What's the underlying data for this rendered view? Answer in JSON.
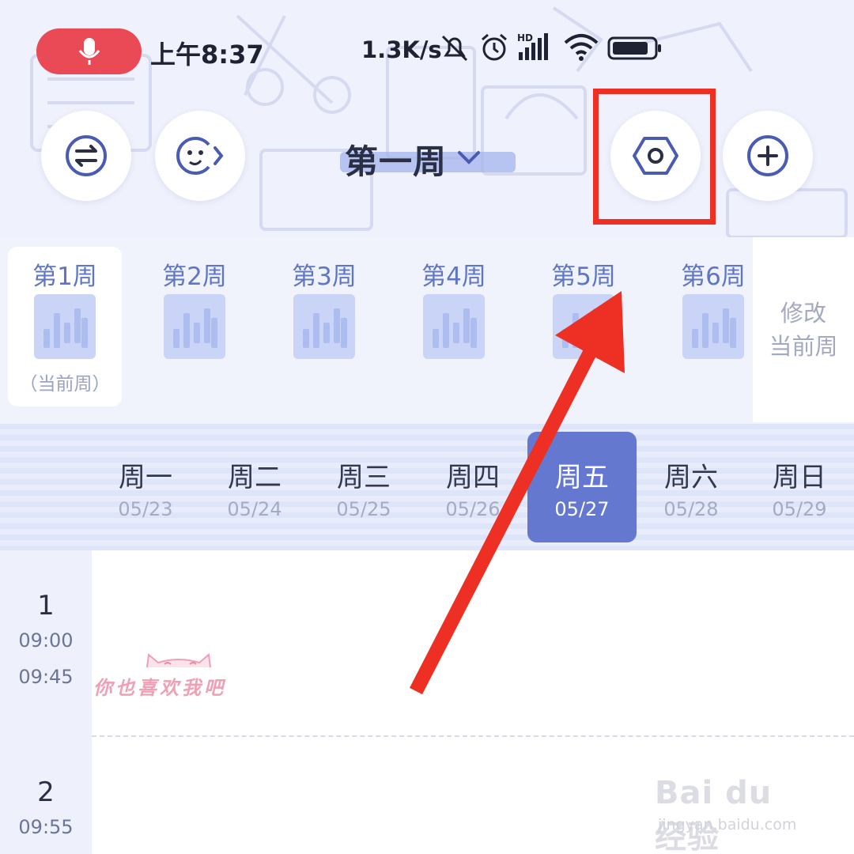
{
  "status_bar": {
    "time": "上午8:37",
    "net_speed": "1.3K/s",
    "icons": [
      "microphone-icon",
      "bell-off-icon",
      "alarm-icon",
      "signal-hd-icon",
      "wifi-icon",
      "battery-icon"
    ],
    "record_color": "#ea4a55"
  },
  "toolbar": {
    "title": "第一周",
    "left_buttons": [
      "swap-icon",
      "face-icon"
    ],
    "right_buttons": [
      "settings-hexagon-icon",
      "add-icon"
    ],
    "highlight_color": "#ee3024"
  },
  "weeks": [
    {
      "label": "第1周",
      "sub": "（当前周）",
      "current": true
    },
    {
      "label": "第2周"
    },
    {
      "label": "第3周"
    },
    {
      "label": "第4周"
    },
    {
      "label": "第5周"
    },
    {
      "label": "第6周"
    }
  ],
  "edit_week": {
    "line1": "修改",
    "line2": "当前周"
  },
  "days": [
    {
      "name": "周一",
      "date": "05/23"
    },
    {
      "name": "周二",
      "date": "05/24"
    },
    {
      "name": "周三",
      "date": "05/25"
    },
    {
      "name": "周四",
      "date": "05/26"
    },
    {
      "name": "周五",
      "date": "05/27",
      "active": true
    },
    {
      "name": "周六",
      "date": "05/28"
    },
    {
      "name": "周日",
      "date": "05/29"
    }
  ],
  "periods": [
    {
      "num": "1",
      "start": "09:00",
      "end": "09:45"
    },
    {
      "num": "2",
      "start": "09:55"
    }
  ],
  "sticker_text": "你也喜欢我吧",
  "watermark": {
    "logo": "Bai du 经验",
    "url": "jingyan.baidu.com"
  },
  "colors": {
    "accent": "#6478cf",
    "week_label": "#5f76c7",
    "annotation": "#ee3024"
  }
}
